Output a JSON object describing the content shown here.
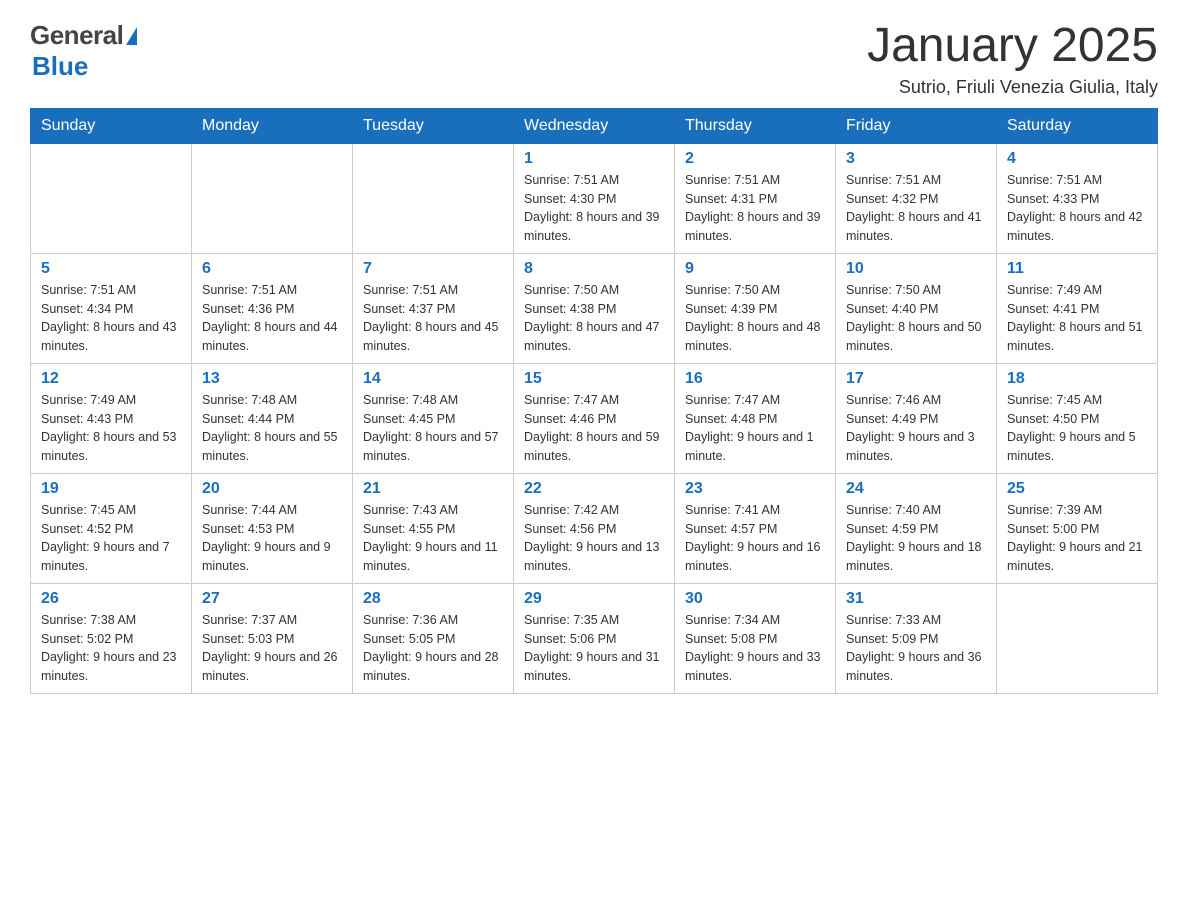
{
  "header": {
    "logo_text": "General",
    "logo_blue": "Blue",
    "month_title": "January 2025",
    "location": "Sutrio, Friuli Venezia Giulia, Italy"
  },
  "days_of_week": [
    "Sunday",
    "Monday",
    "Tuesday",
    "Wednesday",
    "Thursday",
    "Friday",
    "Saturday"
  ],
  "weeks": [
    [
      {
        "day": "",
        "info": ""
      },
      {
        "day": "",
        "info": ""
      },
      {
        "day": "",
        "info": ""
      },
      {
        "day": "1",
        "info": "Sunrise: 7:51 AM\nSunset: 4:30 PM\nDaylight: 8 hours\nand 39 minutes."
      },
      {
        "day": "2",
        "info": "Sunrise: 7:51 AM\nSunset: 4:31 PM\nDaylight: 8 hours\nand 39 minutes."
      },
      {
        "day": "3",
        "info": "Sunrise: 7:51 AM\nSunset: 4:32 PM\nDaylight: 8 hours\nand 41 minutes."
      },
      {
        "day": "4",
        "info": "Sunrise: 7:51 AM\nSunset: 4:33 PM\nDaylight: 8 hours\nand 42 minutes."
      }
    ],
    [
      {
        "day": "5",
        "info": "Sunrise: 7:51 AM\nSunset: 4:34 PM\nDaylight: 8 hours\nand 43 minutes."
      },
      {
        "day": "6",
        "info": "Sunrise: 7:51 AM\nSunset: 4:36 PM\nDaylight: 8 hours\nand 44 minutes."
      },
      {
        "day": "7",
        "info": "Sunrise: 7:51 AM\nSunset: 4:37 PM\nDaylight: 8 hours\nand 45 minutes."
      },
      {
        "day": "8",
        "info": "Sunrise: 7:50 AM\nSunset: 4:38 PM\nDaylight: 8 hours\nand 47 minutes."
      },
      {
        "day": "9",
        "info": "Sunrise: 7:50 AM\nSunset: 4:39 PM\nDaylight: 8 hours\nand 48 minutes."
      },
      {
        "day": "10",
        "info": "Sunrise: 7:50 AM\nSunset: 4:40 PM\nDaylight: 8 hours\nand 50 minutes."
      },
      {
        "day": "11",
        "info": "Sunrise: 7:49 AM\nSunset: 4:41 PM\nDaylight: 8 hours\nand 51 minutes."
      }
    ],
    [
      {
        "day": "12",
        "info": "Sunrise: 7:49 AM\nSunset: 4:43 PM\nDaylight: 8 hours\nand 53 minutes."
      },
      {
        "day": "13",
        "info": "Sunrise: 7:48 AM\nSunset: 4:44 PM\nDaylight: 8 hours\nand 55 minutes."
      },
      {
        "day": "14",
        "info": "Sunrise: 7:48 AM\nSunset: 4:45 PM\nDaylight: 8 hours\nand 57 minutes."
      },
      {
        "day": "15",
        "info": "Sunrise: 7:47 AM\nSunset: 4:46 PM\nDaylight: 8 hours\nand 59 minutes."
      },
      {
        "day": "16",
        "info": "Sunrise: 7:47 AM\nSunset: 4:48 PM\nDaylight: 9 hours\nand 1 minute."
      },
      {
        "day": "17",
        "info": "Sunrise: 7:46 AM\nSunset: 4:49 PM\nDaylight: 9 hours\nand 3 minutes."
      },
      {
        "day": "18",
        "info": "Sunrise: 7:45 AM\nSunset: 4:50 PM\nDaylight: 9 hours\nand 5 minutes."
      }
    ],
    [
      {
        "day": "19",
        "info": "Sunrise: 7:45 AM\nSunset: 4:52 PM\nDaylight: 9 hours\nand 7 minutes."
      },
      {
        "day": "20",
        "info": "Sunrise: 7:44 AM\nSunset: 4:53 PM\nDaylight: 9 hours\nand 9 minutes."
      },
      {
        "day": "21",
        "info": "Sunrise: 7:43 AM\nSunset: 4:55 PM\nDaylight: 9 hours\nand 11 minutes."
      },
      {
        "day": "22",
        "info": "Sunrise: 7:42 AM\nSunset: 4:56 PM\nDaylight: 9 hours\nand 13 minutes."
      },
      {
        "day": "23",
        "info": "Sunrise: 7:41 AM\nSunset: 4:57 PM\nDaylight: 9 hours\nand 16 minutes."
      },
      {
        "day": "24",
        "info": "Sunrise: 7:40 AM\nSunset: 4:59 PM\nDaylight: 9 hours\nand 18 minutes."
      },
      {
        "day": "25",
        "info": "Sunrise: 7:39 AM\nSunset: 5:00 PM\nDaylight: 9 hours\nand 21 minutes."
      }
    ],
    [
      {
        "day": "26",
        "info": "Sunrise: 7:38 AM\nSunset: 5:02 PM\nDaylight: 9 hours\nand 23 minutes."
      },
      {
        "day": "27",
        "info": "Sunrise: 7:37 AM\nSunset: 5:03 PM\nDaylight: 9 hours\nand 26 minutes."
      },
      {
        "day": "28",
        "info": "Sunrise: 7:36 AM\nSunset: 5:05 PM\nDaylight: 9 hours\nand 28 minutes."
      },
      {
        "day": "29",
        "info": "Sunrise: 7:35 AM\nSunset: 5:06 PM\nDaylight: 9 hours\nand 31 minutes."
      },
      {
        "day": "30",
        "info": "Sunrise: 7:34 AM\nSunset: 5:08 PM\nDaylight: 9 hours\nand 33 minutes."
      },
      {
        "day": "31",
        "info": "Sunrise: 7:33 AM\nSunset: 5:09 PM\nDaylight: 9 hours\nand 36 minutes."
      },
      {
        "day": "",
        "info": ""
      }
    ]
  ]
}
